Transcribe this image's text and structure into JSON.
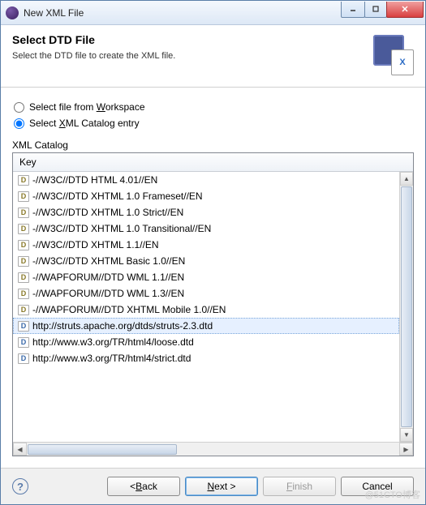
{
  "window": {
    "title": "New XML File"
  },
  "banner": {
    "title": "Select DTD File",
    "desc": "Select the DTD file to create the XML file."
  },
  "radios": {
    "workspace": "Select file from ",
    "workspace_mn": "W",
    "workspace_rest": "orkspace",
    "catalog": "Select ",
    "catalog_mn": "X",
    "catalog_rest": "ML Catalog entry"
  },
  "group_label": "XML Catalog",
  "column_header": "Key",
  "items": [
    {
      "icon": "D",
      "label": "-//W3C//DTD HTML 4.01//EN",
      "selected": false
    },
    {
      "icon": "D",
      "label": "-//W3C//DTD XHTML 1.0 Frameset//EN",
      "selected": false
    },
    {
      "icon": "D",
      "label": "-//W3C//DTD XHTML 1.0 Strict//EN",
      "selected": false
    },
    {
      "icon": "D",
      "label": "-//W3C//DTD XHTML 1.0 Transitional//EN",
      "selected": false
    },
    {
      "icon": "D",
      "label": "-//W3C//DTD XHTML 1.1//EN",
      "selected": false
    },
    {
      "icon": "D",
      "label": "-//W3C//DTD XHTML Basic 1.0//EN",
      "selected": false
    },
    {
      "icon": "D",
      "label": "-//WAPFORUM//DTD WML 1.1//EN",
      "selected": false
    },
    {
      "icon": "D",
      "label": "-//WAPFORUM//DTD WML 1.3//EN",
      "selected": false
    },
    {
      "icon": "D",
      "label": "-//WAPFORUM//DTD XHTML Mobile 1.0//EN",
      "selected": false
    },
    {
      "icon": "D",
      "label": "http://struts.apache.org/dtds/struts-2.3.dtd",
      "selected": true
    },
    {
      "icon": "D",
      "label": "http://www.w3.org/TR/html4/loose.dtd",
      "selected": false
    },
    {
      "icon": "D",
      "label": "http://www.w3.org/TR/html4/strict.dtd",
      "selected": false
    }
  ],
  "buttons": {
    "back_lt": "< ",
    "back_mn": "B",
    "back_rest": "ack",
    "next_mn": "N",
    "next_rest": "ext >",
    "finish_mn": "F",
    "finish_rest": "inish",
    "cancel": "Cancel"
  },
  "watermark": "@51CTO博客"
}
